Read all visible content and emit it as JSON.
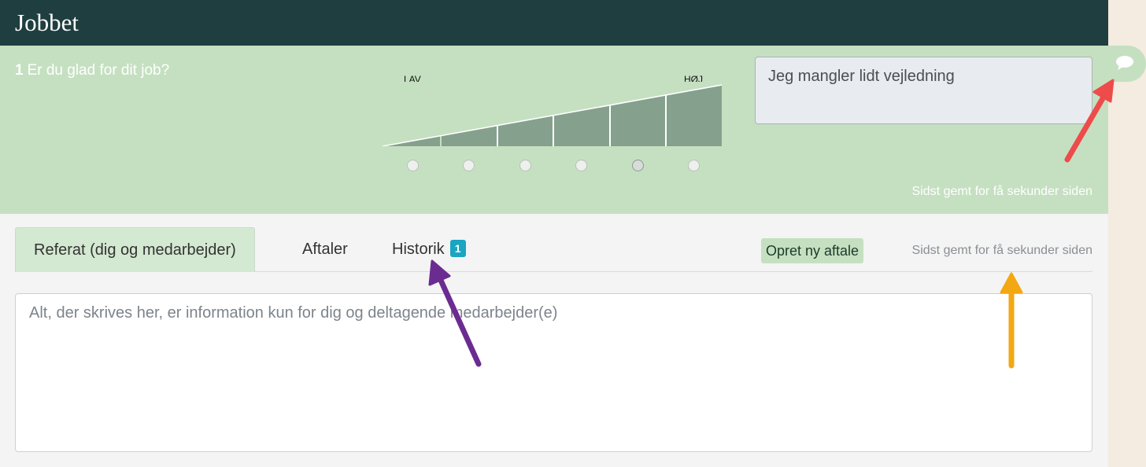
{
  "header": {
    "title": "Jobbet"
  },
  "question": {
    "number": "1",
    "text": "Er du glad for dit job?",
    "scale": {
      "low_label": "LAV",
      "high_label": "HØJ",
      "options": 6,
      "selected_index": 4
    },
    "comment": "Jeg mangler lidt vejledning",
    "comment_icon": "speech-bubble-icon",
    "saved_text": "Sidst gemt for få sekunder siden"
  },
  "tabs": [
    {
      "label": "Referat (dig og medarbejder)",
      "active": true
    },
    {
      "label": "Aftaler",
      "active": false
    },
    {
      "label": "Historik",
      "active": false,
      "badge": "1"
    }
  ],
  "toolbar": {
    "new_agreement_label": "Opret ny aftale",
    "saved_text": "Sidst gemt for få sekunder siden"
  },
  "notes": {
    "placeholder": "Alt, der skrives her, er information kun for dig og deltagende medarbejder(e)"
  },
  "colors": {
    "header": "#1f3e40",
    "panel": "#c5e0c1",
    "scale_fill": "#86a08e",
    "badge": "#1aa5c0",
    "arrow_red": "#ee4b4b",
    "arrow_purple": "#6b2c91",
    "arrow_orange": "#f3a712"
  }
}
